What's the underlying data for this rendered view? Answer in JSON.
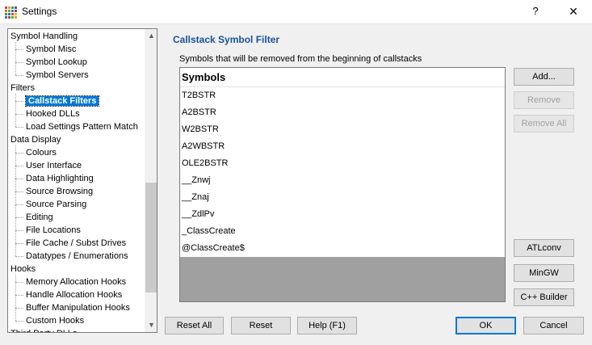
{
  "window": {
    "title": "Settings",
    "help_label": "?",
    "close_label": "✕",
    "icon_colors": [
      "#d04040",
      "#e0a030",
      "#40a040",
      "#3060c0",
      "#e07030",
      "#50b050",
      "#4070d0",
      "#c03030",
      "#30a030",
      "#4060c0",
      "#d05030",
      "#e0b020",
      "#3070d0",
      "#c04040",
      "#40b040",
      "#e0a020"
    ]
  },
  "tree": {
    "scroll_up": "▲",
    "scroll_down": "▼",
    "items": [
      {
        "label": "Symbol Handling",
        "level": 0
      },
      {
        "label": "Symbol Misc",
        "level": 1
      },
      {
        "label": "Symbol Lookup",
        "level": 1
      },
      {
        "label": "Symbol Servers",
        "level": 1
      },
      {
        "label": "Filters",
        "level": 0
      },
      {
        "label": "Callstack Filters",
        "level": 1,
        "selected": true
      },
      {
        "label": "Hooked DLLs",
        "level": 1
      },
      {
        "label": "Load Settings Pattern Match",
        "level": 1
      },
      {
        "label": "Data Display",
        "level": 0
      },
      {
        "label": "Colours",
        "level": 1
      },
      {
        "label": "User Interface",
        "level": 1
      },
      {
        "label": "Data Highlighting",
        "level": 1
      },
      {
        "label": "Source Browsing",
        "level": 1
      },
      {
        "label": "Source Parsing",
        "level": 1
      },
      {
        "label": "Editing",
        "level": 1
      },
      {
        "label": "File Locations",
        "level": 1
      },
      {
        "label": "File Cache / Subst Drives",
        "level": 1
      },
      {
        "label": "Datatypes / Enumerations",
        "level": 1
      },
      {
        "label": "Hooks",
        "level": 0
      },
      {
        "label": "Memory Allocation Hooks",
        "level": 1
      },
      {
        "label": "Handle Allocation Hooks",
        "level": 1
      },
      {
        "label": "Buffer Manipulation Hooks",
        "level": 1
      },
      {
        "label": "Custom Hooks",
        "level": 1
      },
      {
        "label": "Third Party DLLs",
        "level": 0
      }
    ]
  },
  "panel": {
    "title": "Callstack Symbol Filter",
    "description": "Symbols that will be removed from the beginning of callstacks",
    "column_header": "Symbols",
    "symbols": [
      "T2BSTR",
      "A2BSTR",
      "W2BSTR",
      "A2WBSTR",
      "OLE2BSTR",
      "__Znwj",
      "__Znaj",
      "__ZdlPv",
      "_ClassCreate",
      "@ClassCreate$"
    ]
  },
  "buttons": {
    "add": "Add...",
    "remove": "Remove",
    "remove_all": "Remove All",
    "atlconv": "ATLconv",
    "mingw": "MinGW",
    "cpp_builder": "C++ Builder",
    "reset_all": "Reset All",
    "reset": "Reset",
    "help": "Help (F1)",
    "ok": "OK",
    "cancel": "Cancel"
  }
}
